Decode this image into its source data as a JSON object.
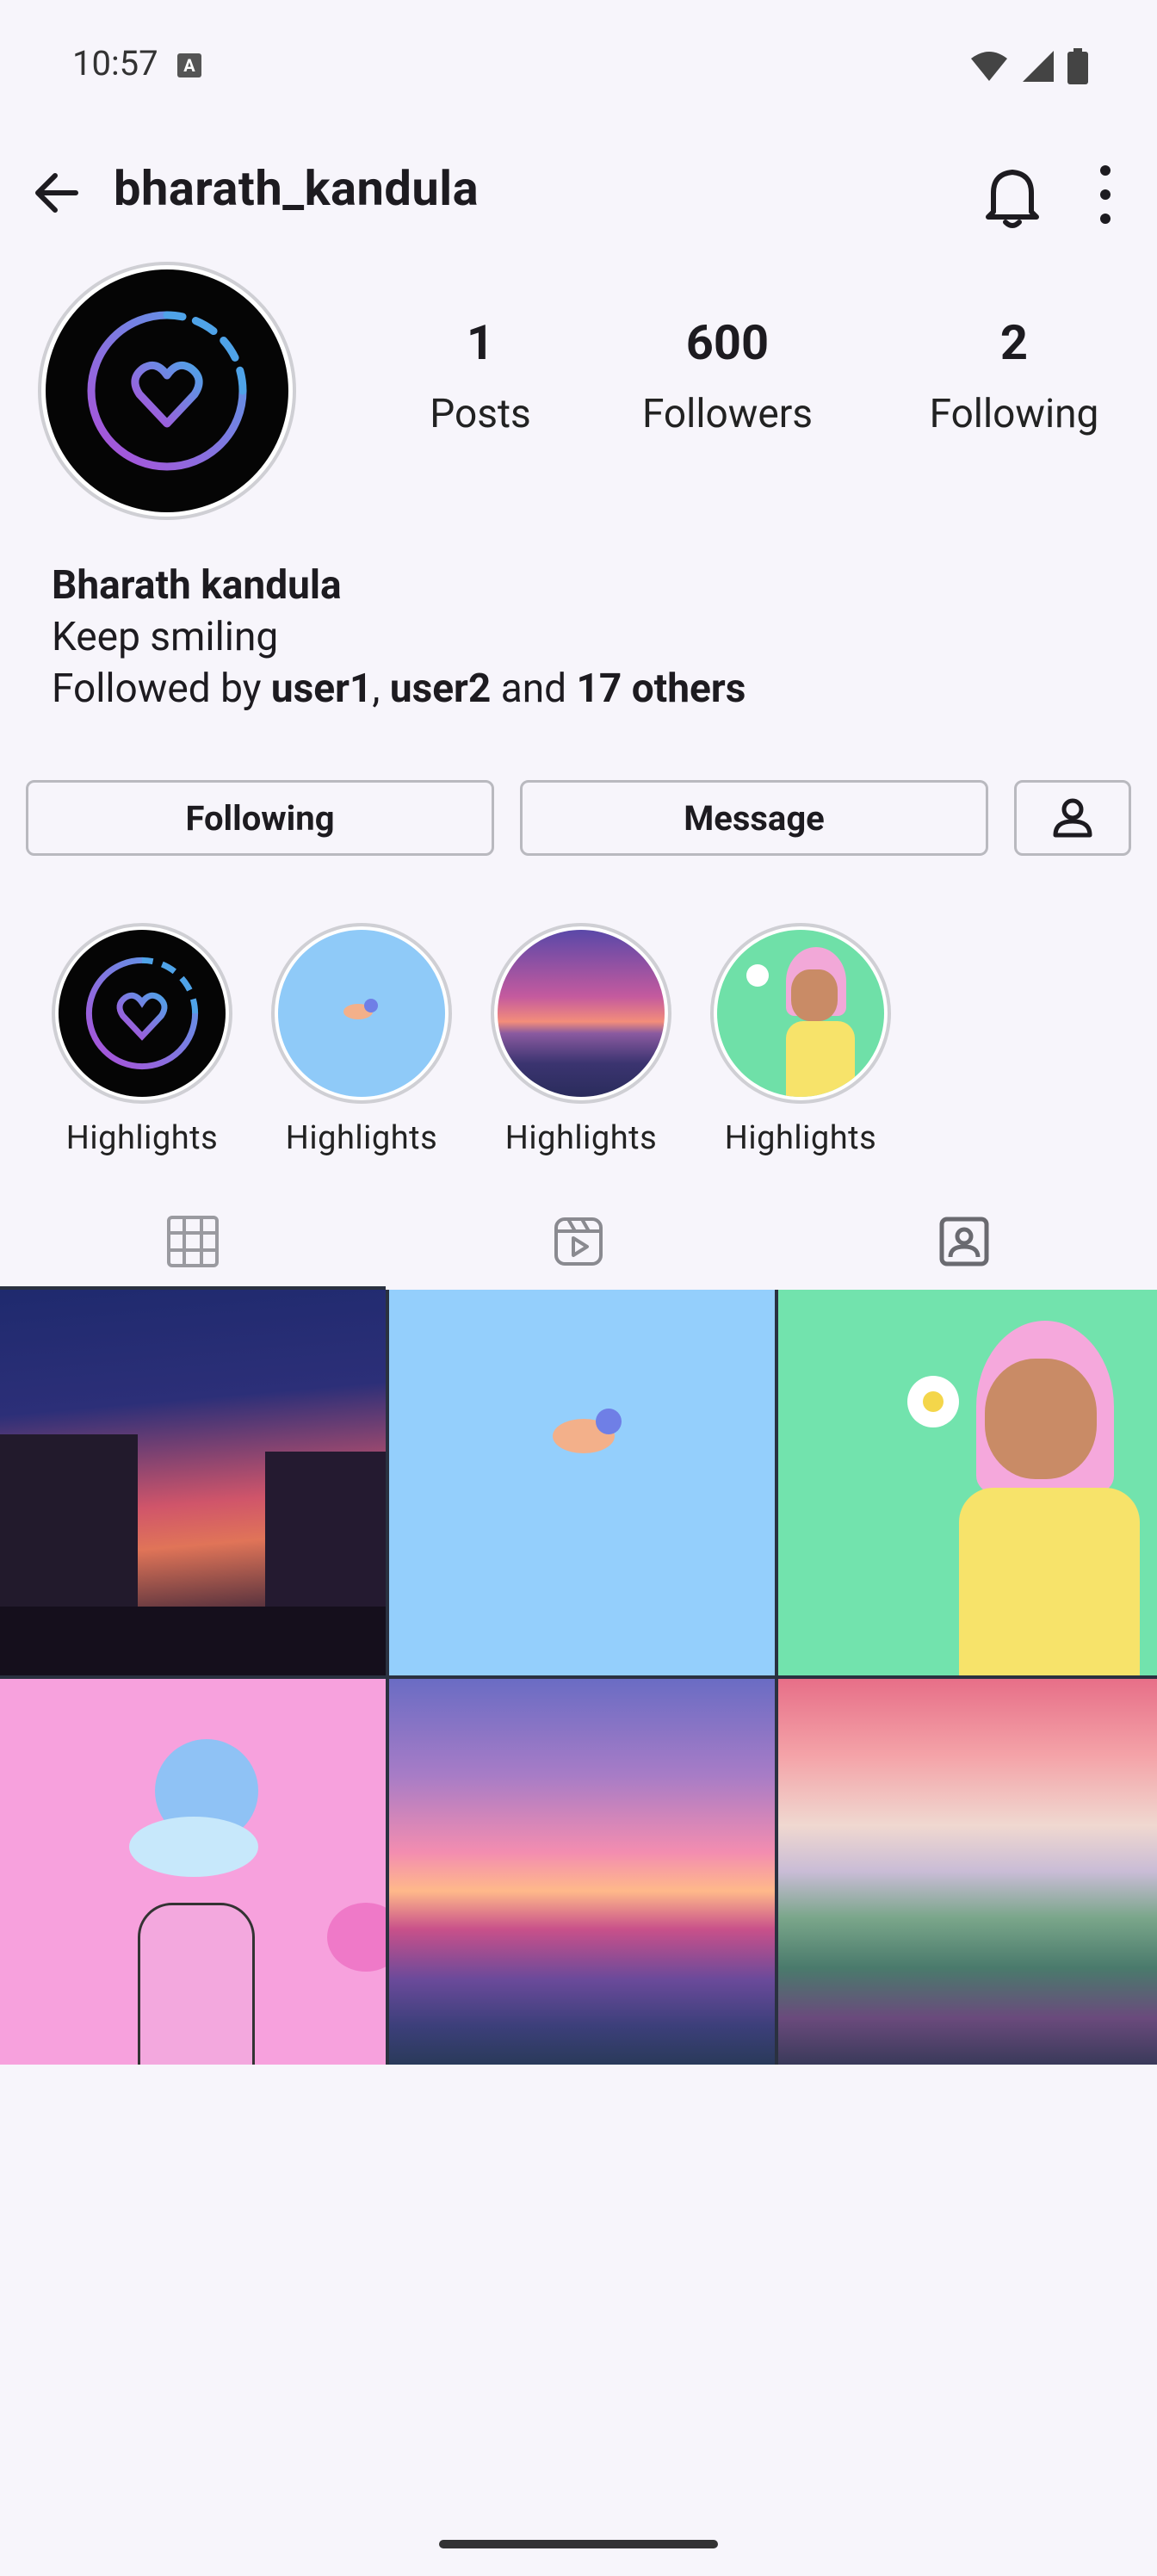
{
  "status_bar": {
    "time": "10:57"
  },
  "header": {
    "username": "bharath_kandula"
  },
  "stats": [
    {
      "value": "1",
      "label": "Posts"
    },
    {
      "value": "600",
      "label": "Followers"
    },
    {
      "value": "2",
      "label": "Following"
    }
  ],
  "bio": {
    "name": "Bharath kandula",
    "text": "Keep smiling",
    "followed_prefix": "Followed by ",
    "user1": "user1",
    "comma": ", ",
    "user2": "user2",
    "and": " and ",
    "others": "17 others"
  },
  "actions": {
    "following": "Following",
    "message": "Message"
  },
  "highlights": [
    {
      "label": "Highlights"
    },
    {
      "label": "Highlights"
    },
    {
      "label": "Highlights"
    },
    {
      "label": "Highlights"
    }
  ],
  "colors": {
    "accent": "#2a3140",
    "background": "#f7f5fb"
  }
}
